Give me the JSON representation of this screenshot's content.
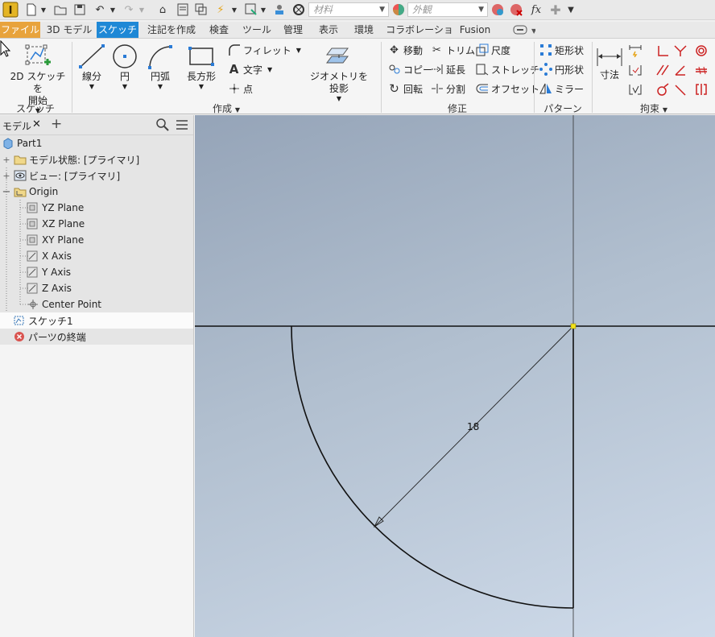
{
  "qat": {
    "material_placeholder": "材料",
    "appearance_placeholder": "外観",
    "fx_label": "fx"
  },
  "tabs": [
    {
      "label": "ファイル"
    },
    {
      "label": "3D モデル"
    },
    {
      "label": "スケッチ"
    },
    {
      "label": "注記を作成"
    },
    {
      "label": "検査"
    },
    {
      "label": "ツール"
    },
    {
      "label": "管理"
    },
    {
      "label": "表示"
    },
    {
      "label": "環境"
    },
    {
      "label": "コラボレーション"
    },
    {
      "label": "Fusion"
    }
  ],
  "ribbon": {
    "sketch_group": {
      "start_2d_line1": "2D スケッチを",
      "start_2d_line2": "開始",
      "label": "スケッチ"
    },
    "create_group": {
      "line": "線分",
      "circle": "円",
      "arc": "円弧",
      "rectangle": "長方形",
      "fillet": "フィレット",
      "text": "文字",
      "point": "点",
      "label": "作成"
    },
    "project_geometry": "ジオメトリを投影",
    "modify_group": {
      "move": "移動",
      "copy": "コピー",
      "rotate": "回転",
      "trim": "トリム",
      "extend": "延長",
      "split": "分割",
      "scale": "尺度",
      "stretch": "ストレッチ",
      "offset": "オフセット",
      "label": "修正"
    },
    "pattern_group": {
      "rectangular": "矩形状",
      "circular": "円形状",
      "mirror": "ミラー",
      "label": "パターン"
    },
    "constrain_group": {
      "dimension": "寸法",
      "label": "拘束"
    }
  },
  "browser": {
    "tab_label": "モデル",
    "tree": [
      {
        "label": "Part1"
      },
      {
        "label": "モデル状態: [プライマリ]"
      },
      {
        "label": "ビュー: [プライマリ]"
      },
      {
        "label": "Origin"
      },
      {
        "label": "YZ Plane"
      },
      {
        "label": "XZ Plane"
      },
      {
        "label": "XY Plane"
      },
      {
        "label": "X Axis"
      },
      {
        "label": "Y Axis"
      },
      {
        "label": "Z Axis"
      },
      {
        "label": "Center Point"
      },
      {
        "label": "スケッチ1"
      },
      {
        "label": "パーツの終端"
      }
    ]
  },
  "canvas": {
    "dimension_value": "18"
  },
  "colors": {
    "file_tab": "#e8a33c",
    "active_tab": "#1e88d6",
    "sketch_line": "#111111",
    "origin_point": "#f2e21b"
  }
}
